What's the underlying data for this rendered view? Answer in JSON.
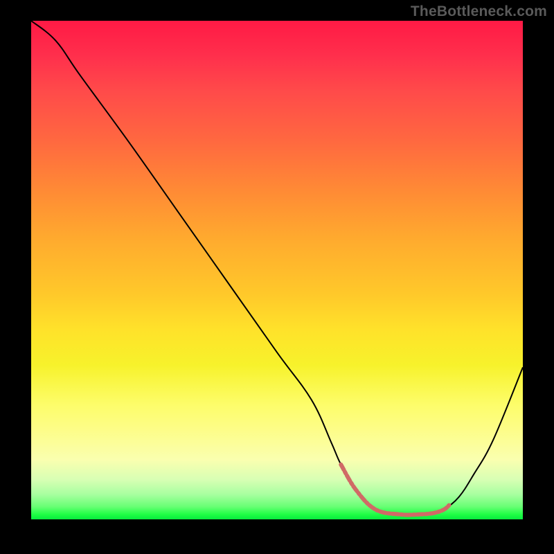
{
  "watermark": {
    "text": "TheBottleneck.com"
  },
  "colors": {
    "background": "#000000",
    "curve_stroke": "#000000",
    "accent_segment": "#d06a66",
    "gradient_top": "#ff1a45",
    "gradient_bottom": "#07e93e"
  },
  "chart_data": {
    "type": "line",
    "title": "",
    "xlabel": "",
    "ylabel": "",
    "xlim": [
      0,
      100
    ],
    "ylim": [
      0,
      100
    ],
    "grid": false,
    "legend": false,
    "x": [
      0,
      5,
      10,
      20,
      30,
      40,
      50,
      57,
      61,
      63,
      66,
      70,
      75,
      79,
      82,
      84,
      87,
      90,
      94,
      100
    ],
    "values": [
      100,
      96,
      89,
      75.5,
      61.5,
      47.5,
      33.5,
      24,
      15.5,
      11,
      6,
      2,
      1,
      1,
      1.3,
      2,
      4.5,
      9,
      16,
      30.5
    ],
    "accent_range": {
      "x_start": 63,
      "x_end": 85
    },
    "series": [
      {
        "name": "bottleneck-curve",
        "x": [
          0,
          5,
          10,
          20,
          30,
          40,
          50,
          57,
          61,
          63,
          66,
          70,
          75,
          79,
          82,
          84,
          87,
          90,
          94,
          100
        ],
        "values": [
          100,
          96,
          89,
          75.5,
          61.5,
          47.5,
          33.5,
          24,
          15.5,
          11,
          6,
          2,
          1,
          1,
          1.3,
          2,
          4.5,
          9,
          16,
          30.5
        ]
      }
    ]
  }
}
